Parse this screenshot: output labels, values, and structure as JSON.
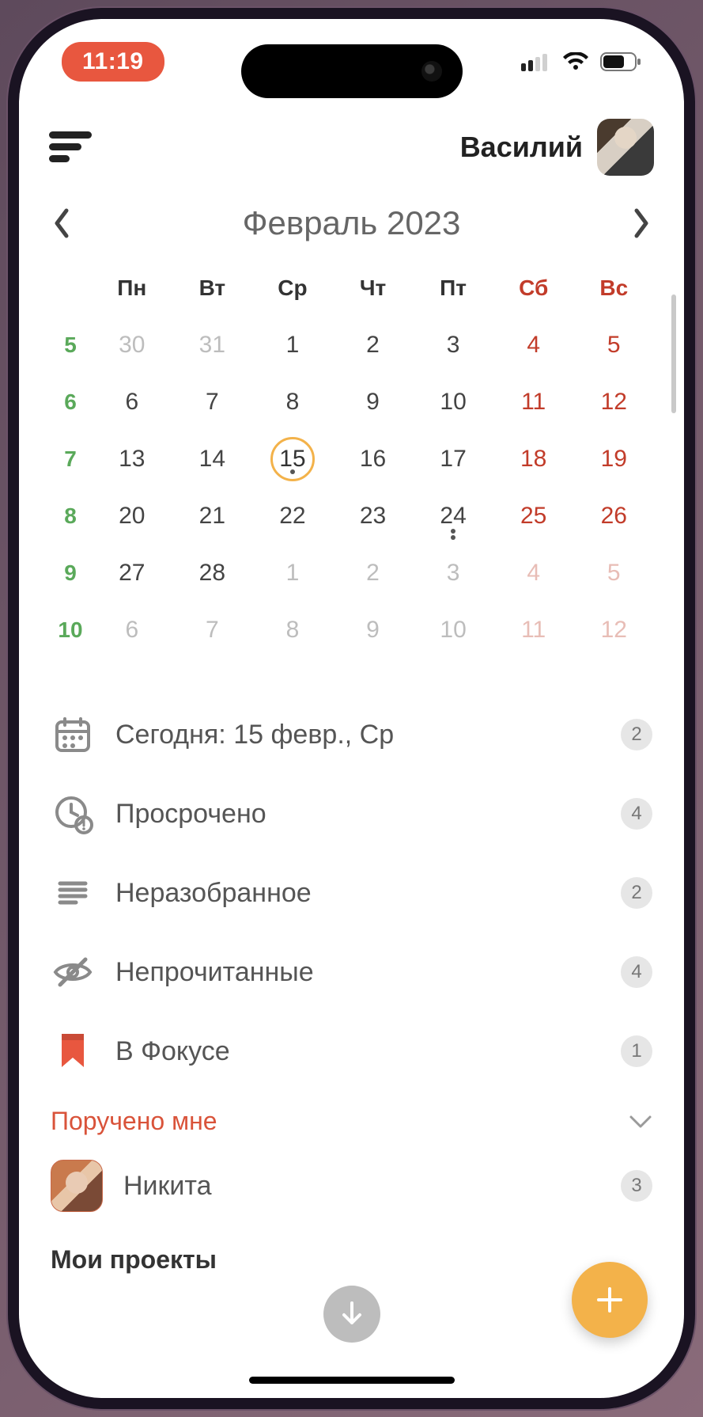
{
  "status": {
    "time": "11:19"
  },
  "header": {
    "username": "Василий"
  },
  "calendar": {
    "title": "Февраль 2023",
    "weekdays": [
      "Пн",
      "Вт",
      "Ср",
      "Чт",
      "Пт",
      "Сб",
      "Вс"
    ],
    "rows": [
      {
        "week": "5",
        "days": [
          {
            "n": "30",
            "other": true
          },
          {
            "n": "31",
            "other": true
          },
          {
            "n": "1"
          },
          {
            "n": "2"
          },
          {
            "n": "3"
          },
          {
            "n": "4",
            "weekend": true
          },
          {
            "n": "5",
            "weekend": true
          }
        ]
      },
      {
        "week": "6",
        "days": [
          {
            "n": "6"
          },
          {
            "n": "7"
          },
          {
            "n": "8"
          },
          {
            "n": "9"
          },
          {
            "n": "10"
          },
          {
            "n": "11",
            "weekend": true
          },
          {
            "n": "12",
            "weekend": true
          }
        ]
      },
      {
        "week": "7",
        "days": [
          {
            "n": "13"
          },
          {
            "n": "14"
          },
          {
            "n": "15",
            "today": true,
            "dot": true
          },
          {
            "n": "16"
          },
          {
            "n": "17"
          },
          {
            "n": "18",
            "weekend": true
          },
          {
            "n": "19",
            "weekend": true
          }
        ]
      },
      {
        "week": "8",
        "days": [
          {
            "n": "20"
          },
          {
            "n": "21"
          },
          {
            "n": "22"
          },
          {
            "n": "23"
          },
          {
            "n": "24",
            "dot": true
          },
          {
            "n": "25",
            "weekend": true
          },
          {
            "n": "26",
            "weekend": true
          }
        ]
      },
      {
        "week": "9",
        "days": [
          {
            "n": "27"
          },
          {
            "n": "28"
          },
          {
            "n": "1",
            "other": true
          },
          {
            "n": "2",
            "other": true
          },
          {
            "n": "3",
            "other": true
          },
          {
            "n": "4",
            "other": true,
            "weekend": true
          },
          {
            "n": "5",
            "other": true,
            "weekend": true
          }
        ]
      },
      {
        "week": "10",
        "days": [
          {
            "n": "6",
            "other": true
          },
          {
            "n": "7",
            "other": true
          },
          {
            "n": "8",
            "other": true
          },
          {
            "n": "9",
            "other": true
          },
          {
            "n": "10",
            "other": true
          },
          {
            "n": "11",
            "other": true,
            "weekend": true
          },
          {
            "n": "12",
            "other": true,
            "weekend": true
          }
        ]
      }
    ]
  },
  "filters": [
    {
      "icon": "calendar",
      "label": "Сегодня: 15 февр., Ср",
      "count": "2"
    },
    {
      "icon": "overdue",
      "label": "Просрочено",
      "count": "4"
    },
    {
      "icon": "inbox",
      "label": "Неразобранное",
      "count": "2"
    },
    {
      "icon": "unread",
      "label": "Непрочитанные",
      "count": "4"
    },
    {
      "icon": "focus",
      "label": "В Фокусе",
      "count": "1"
    }
  ],
  "sections": {
    "assigned": {
      "title": "Поручено мне",
      "person_name": "Никита",
      "person_count": "3"
    },
    "projects": {
      "title": "Мои проекты"
    }
  }
}
